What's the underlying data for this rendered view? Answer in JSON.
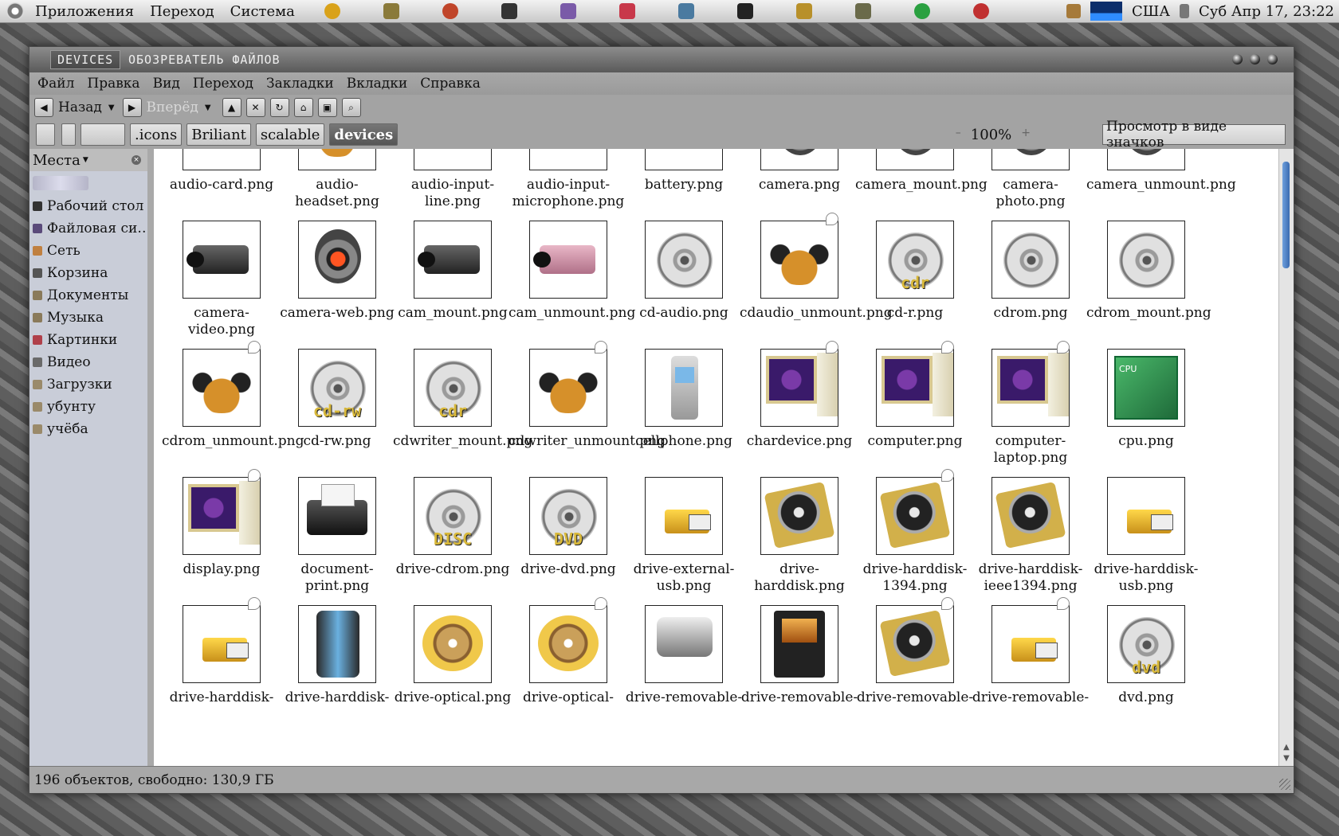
{
  "top_panel": {
    "menus": [
      "Приложения",
      "Переход",
      "Система"
    ],
    "keyboard_layout": "США",
    "clock": "Суб Апр 17, 23:22"
  },
  "window": {
    "title_tab": "DEVICES",
    "title": "ОБОЗРЕВАТЕЛЬ ФАЙЛОВ",
    "menu": [
      "Файл",
      "Правка",
      "Вид",
      "Переход",
      "Закладки",
      "Вкладки",
      "Справка"
    ],
    "toolbar": {
      "back_label": "Назад",
      "forward_label": "Вперёд"
    },
    "breadcrumbs": [
      ".icons",
      "Briliant",
      "scalable",
      "devices"
    ],
    "zoom_level": "100%",
    "view_mode": "Просмотр в виде значков"
  },
  "sidebar": {
    "header": "Места",
    "items": [
      {
        "label": "Рабочий стол",
        "icon": "desktop-icon",
        "color": "#333333"
      },
      {
        "label": "Файловая си…",
        "icon": "filesystem-icon",
        "color": "#5a4a7a"
      },
      {
        "label": "Сеть",
        "icon": "network-icon",
        "color": "#c08040"
      },
      {
        "label": "Корзина",
        "icon": "trash-icon",
        "color": "#555555"
      },
      {
        "label": "Документы",
        "icon": "folder-icon",
        "color": "#8a7a5a"
      },
      {
        "label": "Музыка",
        "icon": "folder-icon",
        "color": "#8a7a5a"
      },
      {
        "label": "Картинки",
        "icon": "folder-icon",
        "color": "#b0404a"
      },
      {
        "label": "Видео",
        "icon": "folder-icon",
        "color": "#6a6a6a"
      },
      {
        "label": "Загрузки",
        "icon": "folder-icon",
        "color": "#9a8a6a"
      },
      {
        "label": "убунту",
        "icon": "folder-icon",
        "color": "#9a8a6a"
      },
      {
        "label": "учёба",
        "icon": "folder-icon",
        "color": "#9a8a6a"
      }
    ]
  },
  "files": [
    {
      "name": "audio-card.png",
      "art": "card"
    },
    {
      "name": "audio-headset.png",
      "art": "headphones"
    },
    {
      "name": "audio-input-line.png",
      "art": "plug"
    },
    {
      "name": "audio-input-microphone.png",
      "art": "plug"
    },
    {
      "name": "battery.png",
      "art": "battery"
    },
    {
      "name": "camera.png",
      "art": "webcam"
    },
    {
      "name": "camera_mount.png",
      "art": "webcam"
    },
    {
      "name": "camera-photo.png",
      "art": "webcam"
    },
    {
      "name": "camera_unmount.png",
      "art": "webcam"
    },
    {
      "name": "camera-video.png",
      "art": "cam"
    },
    {
      "name": "camera-web.png",
      "art": "webcam"
    },
    {
      "name": "cam_mount.png",
      "art": "cam"
    },
    {
      "name": "cam_unmount.png",
      "art": "cam-pink"
    },
    {
      "name": "cd-audio.png",
      "art": "disc"
    },
    {
      "name": "cdaudio_unmount.png",
      "art": "headphones",
      "emblem": true
    },
    {
      "name": "cd-r.png",
      "art": "disc",
      "label": "cdr"
    },
    {
      "name": "cdrom.png",
      "art": "disc"
    },
    {
      "name": "cdrom_mount.png",
      "art": "disc"
    },
    {
      "name": "cdrom_unmount.png",
      "art": "headphones",
      "emblem": true
    },
    {
      "name": "cd-rw.png",
      "art": "disc",
      "label": "cd-rw"
    },
    {
      "name": "cdwriter_mount.png",
      "art": "disc",
      "label": "cdr"
    },
    {
      "name": "cdwriter_unmount.png",
      "art": "headphones",
      "emblem": true
    },
    {
      "name": "cellphone.png",
      "art": "phone"
    },
    {
      "name": "chardevice.png",
      "art": "computer",
      "emblem": true
    },
    {
      "name": "computer.png",
      "art": "computer",
      "emblem": true
    },
    {
      "name": "computer-laptop.png",
      "art": "computer",
      "emblem": true
    },
    {
      "name": "cpu.png",
      "art": "cpu",
      "cpu_text": "CPU"
    },
    {
      "name": "display.png",
      "art": "computer",
      "emblem": true
    },
    {
      "name": "document-print.png",
      "art": "printer"
    },
    {
      "name": "drive-cdrom.png",
      "art": "disc",
      "label": "DISC"
    },
    {
      "name": "drive-dvd.png",
      "art": "disc",
      "label": "DVD"
    },
    {
      "name": "drive-external-usb.png",
      "art": "usb"
    },
    {
      "name": "drive-harddisk.png",
      "art": "hdd"
    },
    {
      "name": "drive-harddisk-1394.png",
      "art": "hdd",
      "emblem": true
    },
    {
      "name": "drive-harddisk-ieee1394.png",
      "art": "hdd"
    },
    {
      "name": "drive-harddisk-usb.png",
      "art": "usb"
    },
    {
      "name": "drive-harddisk-",
      "art": "usb",
      "emblem": true
    },
    {
      "name": "drive-harddisk-",
      "art": "tower"
    },
    {
      "name": "drive-optical.png",
      "art": "optical"
    },
    {
      "name": "drive-optical-",
      "art": "optical",
      "emblem": true
    },
    {
      "name": "drive-removable-",
      "art": "removable"
    },
    {
      "name": "drive-removable-",
      "art": "flash"
    },
    {
      "name": "drive-removable-",
      "art": "hdd",
      "emblem": true
    },
    {
      "name": "drive-removable-",
      "art": "usb",
      "emblem": true
    },
    {
      "name": "dvd.png",
      "art": "disc",
      "label": "dvd"
    }
  ],
  "status_text": "196 объектов, свободно: 130,9 ГБ",
  "colors": {
    "window_bg": "#a9a9a9",
    "sidebar_bg": "#c9cdd8",
    "active_crumb": "#555555",
    "scroll_thumb": "#3a6ab0"
  }
}
